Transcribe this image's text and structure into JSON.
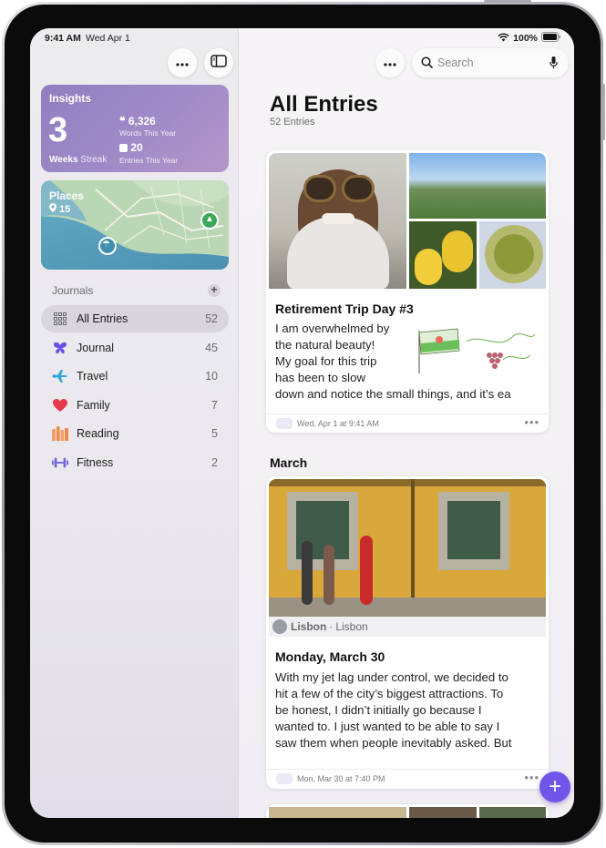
{
  "status_bar": {
    "time": "9:41 AM",
    "date": "Wed Apr 1",
    "battery": "100%"
  },
  "sidebar": {
    "insights": {
      "title": "Insights",
      "streak_value": "3",
      "streak_unit": "Weeks",
      "streak_label": "Streak",
      "words_value": "6,326",
      "words_caption": "Words This Year",
      "entries_value": "20",
      "entries_caption": "Entries This Year"
    },
    "places": {
      "title": "Places",
      "count": "15"
    },
    "journals_header": "Journals",
    "items": [
      {
        "label": "All Entries",
        "count": "52",
        "icon": "grid-icon"
      },
      {
        "label": "Journal",
        "count": "45",
        "icon": "butterfly-icon"
      },
      {
        "label": "Travel",
        "count": "10",
        "icon": "airplane-icon"
      },
      {
        "label": "Family",
        "count": "7",
        "icon": "heart-icon"
      },
      {
        "label": "Reading",
        "count": "5",
        "icon": "books-icon"
      },
      {
        "label": "Fitness",
        "count": "2",
        "icon": "dumbbell-icon"
      }
    ]
  },
  "main": {
    "search_placeholder": "Search",
    "title": "All Entries",
    "subtitle": "52 Entries",
    "entries": [
      {
        "title": "Retirement Trip Day #3",
        "body_lines": [
          "I am overwhelmed by",
          "the natural beauty!",
          "My goal for this trip",
          "has been to slow",
          "down and notice the small things, and it’s ea"
        ],
        "date": "Wed, Apr 1 at 9:41 AM"
      },
      {
        "location_primary": "Lisbon",
        "location_secondary": "· Lisbon",
        "title": "Monday, March 30",
        "body_lines": [
          "With my jet lag under control, we decided to",
          "hit a few of the city’s biggest attractions. To",
          "be honest, I didn’t initially go because I",
          "wanted to. I just wanted to be able to say I",
          "saw them when people inevitably asked. But"
        ],
        "date": "Mon, Mar 30 at 7:40 PM"
      }
    ],
    "month_header": "March"
  },
  "colors": {
    "accent": "#6f56e8",
    "insights_bg": "#9a88c6",
    "selected_row": "#d8d5dc"
  }
}
